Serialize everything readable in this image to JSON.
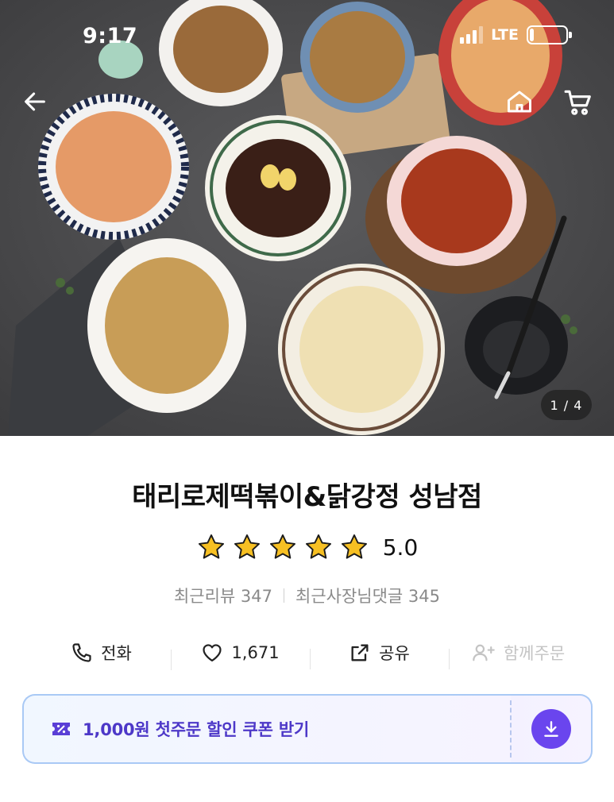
{
  "status_bar": {
    "time": "9:17",
    "network": "LTE",
    "battery_level": 0.12,
    "signal_bars": 3
  },
  "nav": {
    "back_icon": "arrow-left-icon",
    "home_icon": "home-icon",
    "cart_icon": "cart-icon"
  },
  "hero": {
    "image_counter": "1 / 4"
  },
  "store": {
    "title": "태리로제떡볶이&닭강정 성남점",
    "rating_stars": 5,
    "rating_value": "5.0",
    "recent_reviews": "최근리뷰 347",
    "owner_replies": "최근사장님댓글 345"
  },
  "actions": {
    "call_label": "전화",
    "like_count": "1,671",
    "share_label": "공유",
    "group_order_label": "함께주문"
  },
  "coupon": {
    "text": "1,000원 첫주문 할인 쿠폰 받기",
    "accent_color": "#6a45ee"
  }
}
